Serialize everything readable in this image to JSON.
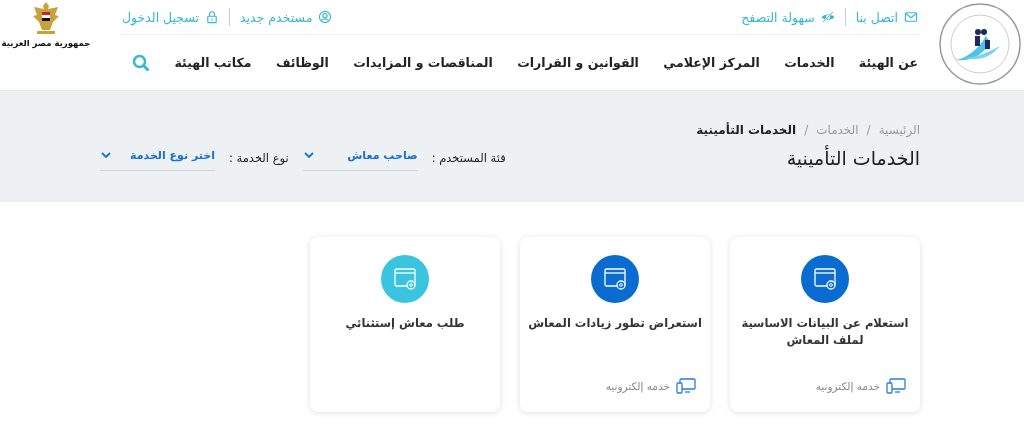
{
  "header": {
    "top_links_right": [
      {
        "label": "اتصل بنا"
      },
      {
        "label": "سهولة التصفح"
      }
    ],
    "top_links_left": [
      {
        "label": "مستخدم جديد"
      },
      {
        "label": "تسجيل الدخول"
      }
    ],
    "nav": [
      "عن الهيئة",
      "الخدمات",
      "المركز الإعلامي",
      "القوانين و القرارات",
      "المناقصات و المزايدات",
      "الوظائف",
      "مكاتب الهيئة"
    ],
    "emblem_caption": "جمهورية مصر العربية"
  },
  "breadcrumb": [
    {
      "kind": "link",
      "label": "الرئيسية",
      "current": false
    },
    {
      "kind": "separator",
      "label": "/"
    },
    {
      "kind": "link",
      "label": "الخدمات",
      "current": false
    },
    {
      "kind": "separator",
      "label": "/"
    },
    {
      "kind": "link",
      "label": "الخدمات التأمينية",
      "current": true
    }
  ],
  "page_title": "الخدمات التأمينية",
  "filters": [
    {
      "label": "فئة المستخدم :",
      "value": "صاحب معاش"
    },
    {
      "label": "نوع الخدمة :",
      "value": "اختر نوع الخدمة"
    }
  ],
  "cards": [
    {
      "title": "استعلام عن البيانات الاساسية لملف المعاش",
      "color": "#0a6bd1",
      "tag": "خدمه إلكترونيه"
    },
    {
      "title": "استعراض تطور زيادات المعاش",
      "color": "#0a6bd1",
      "tag": "خدمه إلكترونيه"
    },
    {
      "title": "طلب معاش إستثنائي",
      "color": "#3ac4df"
    }
  ]
}
